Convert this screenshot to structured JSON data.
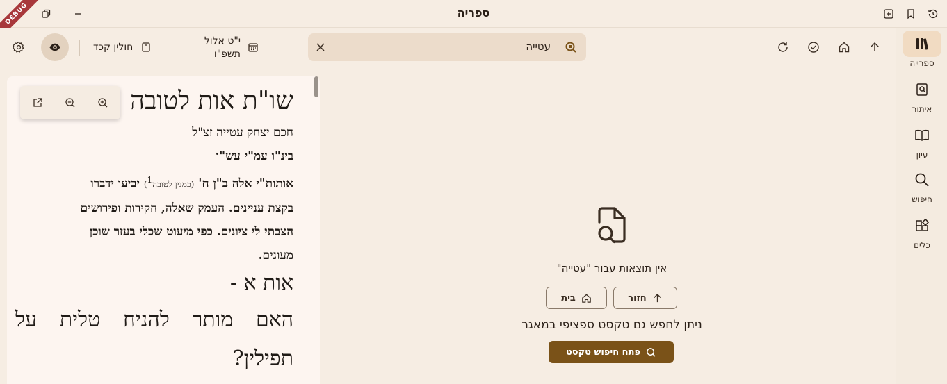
{
  "window": {
    "title": "ספריה",
    "debug_label": "DEBUG"
  },
  "toolbar": {
    "search_value": "עטייה",
    "book_title": "חולין קכד",
    "date_line1": "י\"ט אלול",
    "date_line2": "תשפ\"ו"
  },
  "nav": {
    "items": [
      {
        "label": "ספרייה",
        "icon": "library-icon",
        "active": true
      },
      {
        "label": "איתור",
        "icon": "find-book-icon",
        "active": false
      },
      {
        "label": "עיון",
        "icon": "open-book-icon",
        "active": false
      },
      {
        "label": "חיפוש",
        "icon": "search-icon",
        "active": false
      },
      {
        "label": "כלים",
        "icon": "tools-icon",
        "active": false
      }
    ]
  },
  "reader": {
    "title": "שו\"ת אות לטובה",
    "author": "חכם יצחק עטייה זצ\"ל",
    "dedication": "בינ\"ו עמ\"י עש\"ו",
    "para_lines": [
      {
        "start": "אותות\"י אלה ב\"ן ח'",
        "small": "(כמנין לטובה",
        "sup": "1",
        "small_end": ")",
        "end": "יביעו ידברו"
      },
      {
        "start": "בקצת עניינים. העמק שאלה, חקירות ופירושים"
      },
      {
        "start": "הצבתי לי ציונים. כפי מיעוט שכלי בעזר שוכן"
      },
      {
        "start": "מעונים."
      }
    ],
    "section_heading": "אות א -",
    "question_line1": "האם מותר להניח טלית על",
    "question_line2": "תפילין?"
  },
  "empty_state": {
    "message": "אין תוצאות עבור \"עטייה\"",
    "back_label": "חזור",
    "home_label": "בית",
    "hint": "ניתן לחפש גם טקסט ספציפי במאגר",
    "open_search_label": "פתח חיפוש טקסט"
  },
  "colors": {
    "background": "#f6ede3",
    "accent": "#7a5218",
    "active_nav": "#f1dbc2"
  }
}
